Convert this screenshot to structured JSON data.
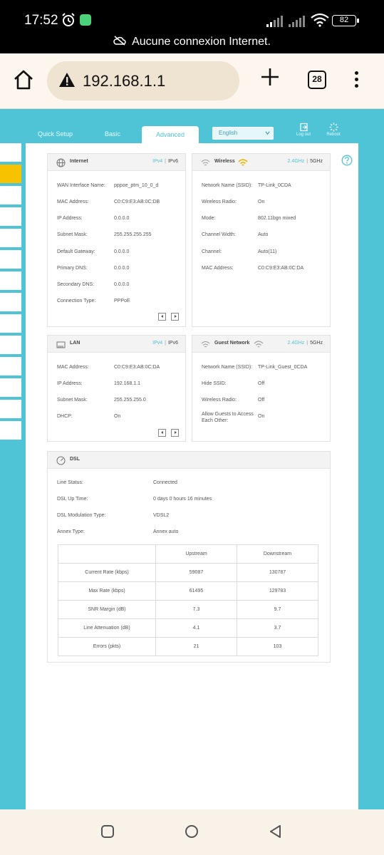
{
  "status_bar": {
    "time": "17:52",
    "battery": "82",
    "notice": "Aucune connexion Internet."
  },
  "browser": {
    "url": "192.168.1.1",
    "tab_count": "28"
  },
  "router": {
    "nav": {
      "quick_setup": "Quick Setup",
      "basic": "Basic",
      "advanced": "Advanced"
    },
    "language": "English",
    "logout": "Log out",
    "reboot": "Reboot",
    "internet": {
      "title": "Internet",
      "tab_ipv4": "IPv4",
      "tab_ipv6": "IPv6",
      "rows": [
        {
          "label": "WAN Interface Name:",
          "value": "pppoe_ptm_10_0_d"
        },
        {
          "label": "MAC Address:",
          "value": "C0:C9:E3:AB:0C:DB"
        },
        {
          "label": "IP Address:",
          "value": "0.0.0.0"
        },
        {
          "label": "Subnet Mask:",
          "value": "255.255.255.255"
        },
        {
          "label": "Default Gateway:",
          "value": "0.0.0.0"
        },
        {
          "label": "Primary DNS:",
          "value": "0.0.0.0"
        },
        {
          "label": "Secondary DNS:",
          "value": "0.0.0.0"
        },
        {
          "label": "Connection Type:",
          "value": "PPPoE"
        }
      ]
    },
    "wireless": {
      "title": "Wireless",
      "tab_24": "2.4GHz",
      "tab_5": "5GHz",
      "rows": [
        {
          "label": "Network Name (SSID):",
          "value": "TP-Link_0CDA"
        },
        {
          "label": "Wireless Radio:",
          "value": "On"
        },
        {
          "label": "Mode:",
          "value": "802.11bgn mixed"
        },
        {
          "label": "Channel Width:",
          "value": "Auto"
        },
        {
          "label": "Channel:",
          "value": "Auto(11)"
        },
        {
          "label": "MAC Address:",
          "value": "C0:C9:E3:AB:0C:DA"
        }
      ]
    },
    "lan": {
      "title": "LAN",
      "tab_ipv4": "IPv4",
      "tab_ipv6": "IPv6",
      "rows": [
        {
          "label": "MAC Address:",
          "value": "C0:C9:E3:AB:0C:DA"
        },
        {
          "label": "IP Address:",
          "value": "192.168.1.1"
        },
        {
          "label": "Subnet Mask:",
          "value": "255.255.255.0"
        },
        {
          "label": "DHCP:",
          "value": "On"
        }
      ]
    },
    "guest": {
      "title": "Guest Network",
      "tab_24": "2.4GHz",
      "tab_5": "5GHz",
      "rows": [
        {
          "label": "Network Name (SSID):",
          "value": "TP-Link_Guest_0CDA"
        },
        {
          "label": "Hide SSID:",
          "value": "Off"
        },
        {
          "label": "Wireless Radio:",
          "value": "Off"
        },
        {
          "label": "Allow Guests to Access Each Other:",
          "value": "On"
        }
      ]
    },
    "dsl": {
      "title": "DSL",
      "rows": [
        {
          "label": "Line Status:",
          "value": "Connected"
        },
        {
          "label": "DSL Up Time:",
          "value": "0 days 0 hours 16 minutes"
        },
        {
          "label": "DSL Modulation Type:",
          "value": "VDSL2"
        },
        {
          "label": "Annex Type:",
          "value": "Annex auto"
        }
      ],
      "table": {
        "headers": [
          "",
          "Upstream",
          "Downstream"
        ],
        "rows": [
          [
            "Current Rate (kbps)",
            "59087",
            "130787"
          ],
          [
            "Max Rate (kbps)",
            "61495",
            "129783"
          ],
          [
            "SNR Margin (dB)",
            "7.3",
            "9.7"
          ],
          [
            "Line Attenuation (dB)",
            "4.1",
            "3.7"
          ],
          [
            "Errors (pkts)",
            "21",
            "103"
          ]
        ]
      }
    }
  },
  "colors": {
    "accent": "#4fc4d6",
    "active_menu": "#f7c200"
  }
}
